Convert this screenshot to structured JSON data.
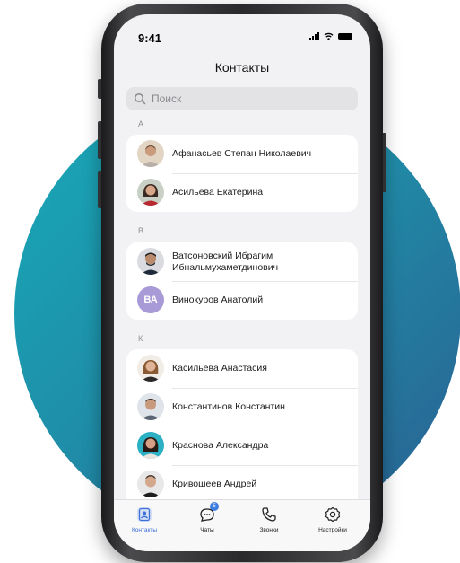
{
  "status_bar": {
    "time": "9:41"
  },
  "header": {
    "title": "Контакты"
  },
  "search": {
    "placeholder": "Поиск"
  },
  "sections": [
    {
      "letter": "А",
      "contacts": [
        {
          "name": "Афанасьев Степан Николаевич",
          "avatar": "photo"
        },
        {
          "name": "Асильева Екатерина",
          "avatar": "photo"
        }
      ]
    },
    {
      "letter": "В",
      "contacts": [
        {
          "name": "Ватсоновский Ибрагим Ибнальмухаметдинович",
          "avatar": "photo"
        },
        {
          "name": "Винокуров Анатолий",
          "avatar": "initials",
          "initials": "ВА",
          "color": "#a89ad6"
        }
      ]
    },
    {
      "letter": "К",
      "contacts": [
        {
          "name": "Касильева Анастасия",
          "avatar": "photo"
        },
        {
          "name": "Константинов Константин",
          "avatar": "photo"
        },
        {
          "name": "Краснова Александра",
          "avatar": "photo"
        },
        {
          "name": "Кривошеев Андрей",
          "avatar": "photo"
        }
      ]
    }
  ],
  "tabbar": {
    "tabs": [
      {
        "label": "Контакты",
        "icon": "contacts-icon",
        "active": true
      },
      {
        "label": "Чаты",
        "icon": "chat-icon",
        "badge": "5"
      },
      {
        "label": "Звонки",
        "icon": "phone-icon"
      },
      {
        "label": "Настройки",
        "icon": "settings-icon"
      }
    ]
  },
  "colors": {
    "accent": "#3d6fd8",
    "background_gradient_start": "#17aab8",
    "background_gradient_end": "#2a5f92"
  }
}
